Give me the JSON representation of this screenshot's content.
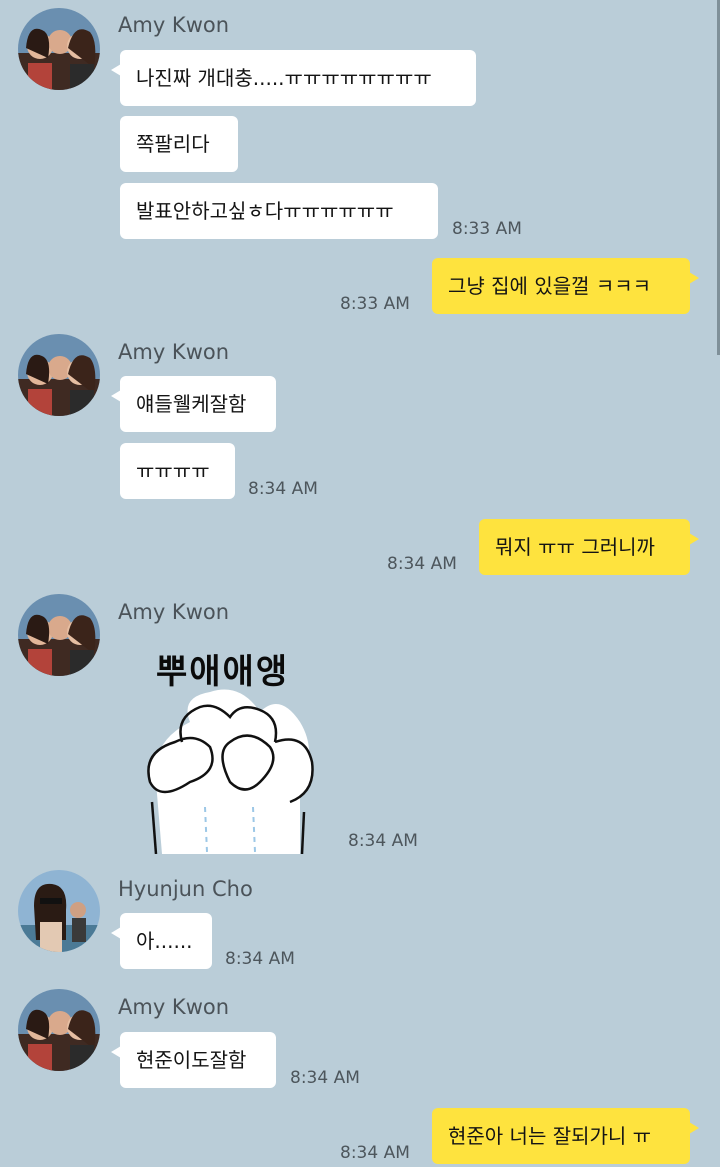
{
  "chat": {
    "scrollbar_color": "#7f9099",
    "colors": {
      "background": "#bacdd8",
      "incoming_bubble": "#ffffff",
      "outgoing_bubble": "#fee33e"
    },
    "group1": {
      "sender": "Amy Kwon",
      "messages": [
        "나진짜 개대충.....ㅠㅠㅠㅠㅠㅠㅠㅠ",
        "쪽팔리다",
        "발표안하고싶ㅎ다ㅠㅠㅠㅠㅠㅠ"
      ],
      "time": "8:33 AM"
    },
    "out1": {
      "message": "그냥 집에 있을껄 ㅋㅋㅋ",
      "time": "8:33 AM"
    },
    "group2": {
      "sender": "Amy Kwon",
      "messages": [
        "얘들웰케잘함",
        "ㅠㅠㅠㅠ"
      ],
      "time": "8:34 AM"
    },
    "out2": {
      "message": "뭐지 ㅠㅠ 그러니까",
      "time": "8:34 AM"
    },
    "group3": {
      "sender": "Amy Kwon",
      "sticker_text": "뿌애애앵",
      "sticker_icon": "crying-character-sticker",
      "time": "8:34 AM"
    },
    "group4": {
      "sender": "Hyunjun Cho",
      "messages": [
        "아......"
      ],
      "time": "8:34 AM"
    },
    "group5": {
      "sender": "Amy Kwon",
      "messages": [
        "현준이도잘함"
      ],
      "time": "8:34 AM"
    },
    "out3": {
      "message": "현준아 너는 잘되가니 ㅠ",
      "time": "8:34 AM"
    }
  }
}
